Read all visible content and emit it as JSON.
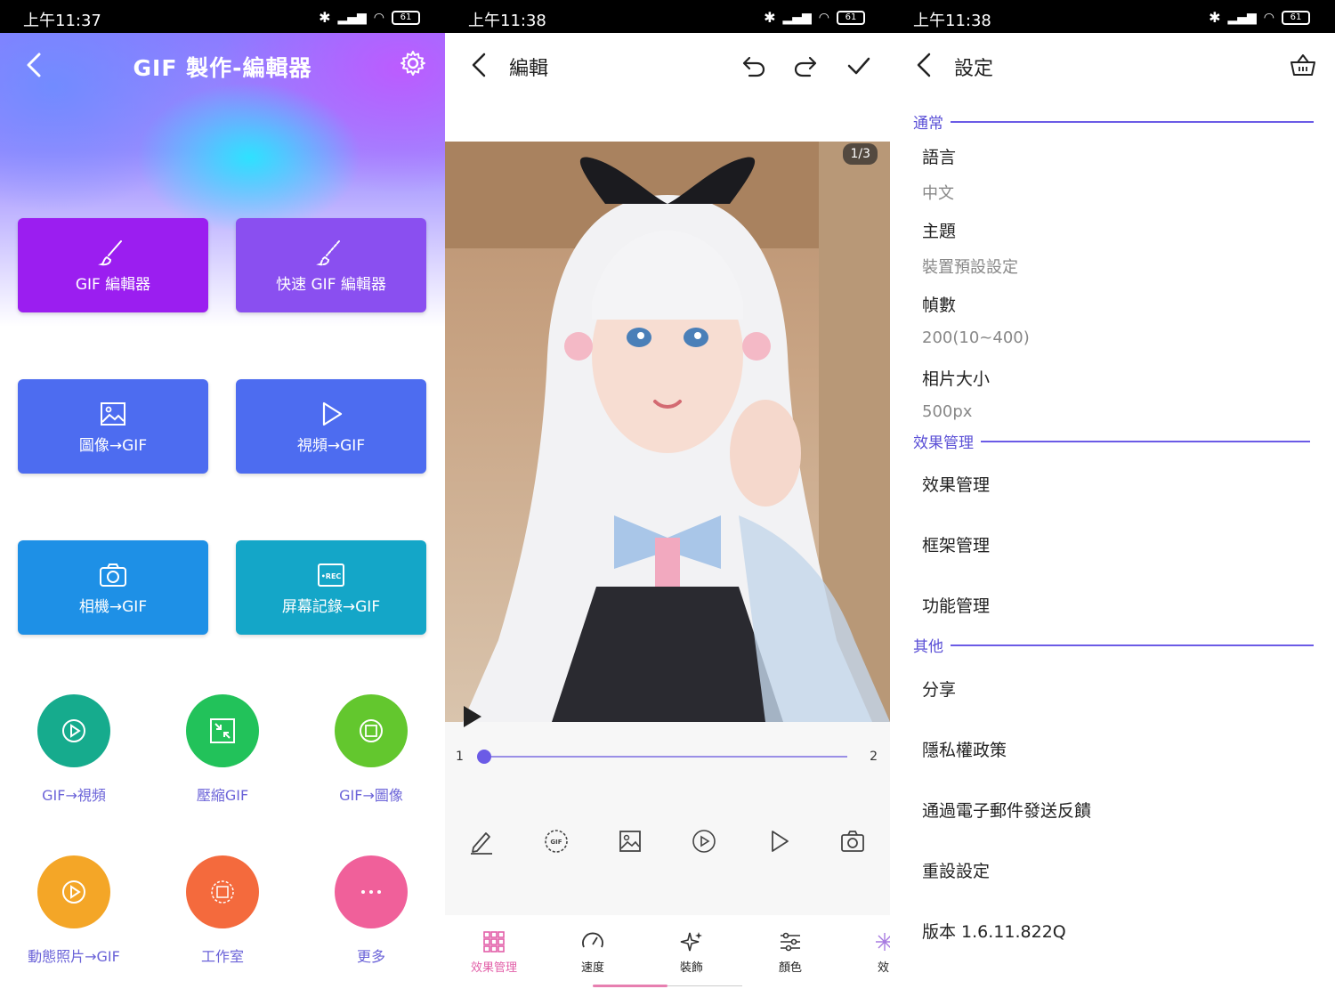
{
  "status": [
    {
      "time": "上午11:37",
      "battery": "61"
    },
    {
      "time": "上午11:38",
      "battery": "61"
    },
    {
      "time": "上午11:38",
      "battery": "61"
    }
  ],
  "home": {
    "title": "GIF 製作-編輯器",
    "buttons": [
      {
        "label": "GIF 編輯器",
        "color": "#9b1ef0"
      },
      {
        "label": "快速 GIF 編輯器",
        "color": "#8a4ff0"
      },
      {
        "label": "圖像→GIF",
        "color": "#4d6cf0"
      },
      {
        "label": "視頻→GIF",
        "color": "#4d6cf0"
      },
      {
        "label": "相機→GIF",
        "color": "#1e90e6"
      },
      {
        "label": "屏幕記錄→GIF",
        "color": "#14a6c8"
      }
    ],
    "circles": [
      {
        "label": "GIF→視頻",
        "color": "#16ab8d"
      },
      {
        "label": "壓縮GIF",
        "color": "#22c25a"
      },
      {
        "label": "GIF→圖像",
        "color": "#63c72e"
      },
      {
        "label": "動態照片→GIF",
        "color": "#f4a627"
      },
      {
        "label": "工作室",
        "color": "#f46a3d"
      },
      {
        "label": "更多",
        "color": "#f0609a"
      }
    ]
  },
  "editor": {
    "title": "編輯",
    "frame_badge": "1/3",
    "timeline_start": "1",
    "timeline_end": "2",
    "nav": [
      {
        "label": "效果管理",
        "color": "#e25fa8"
      },
      {
        "label": "速度"
      },
      {
        "label": "裝飾"
      },
      {
        "label": "顏色"
      },
      {
        "label": "效"
      }
    ]
  },
  "settings": {
    "title": "設定",
    "sections": {
      "general": "通常",
      "effects": "效果管理",
      "other": "其他"
    },
    "language": {
      "label": "語言",
      "value": "中文"
    },
    "theme": {
      "label": "主題",
      "value": "裝置預設設定"
    },
    "frames": {
      "label": "幀數",
      "value": "200(10~400)"
    },
    "photo_size": {
      "label": "相片大小",
      "value": "500px"
    },
    "effect_items": [
      "效果管理",
      "框架管理",
      "功能管理"
    ],
    "other_items": [
      "分享",
      "隱私權政策",
      "通過電子郵件發送反饋",
      "重設設定",
      "版本 1.6.11.822Q"
    ]
  },
  "icons": [
    "back-arrow-icon",
    "gear-icon",
    "brush-icon",
    "image-icon",
    "play-icon",
    "camera-icon",
    "rec-icon",
    "undo-icon",
    "redo-icon",
    "check-icon",
    "basket-icon"
  ]
}
